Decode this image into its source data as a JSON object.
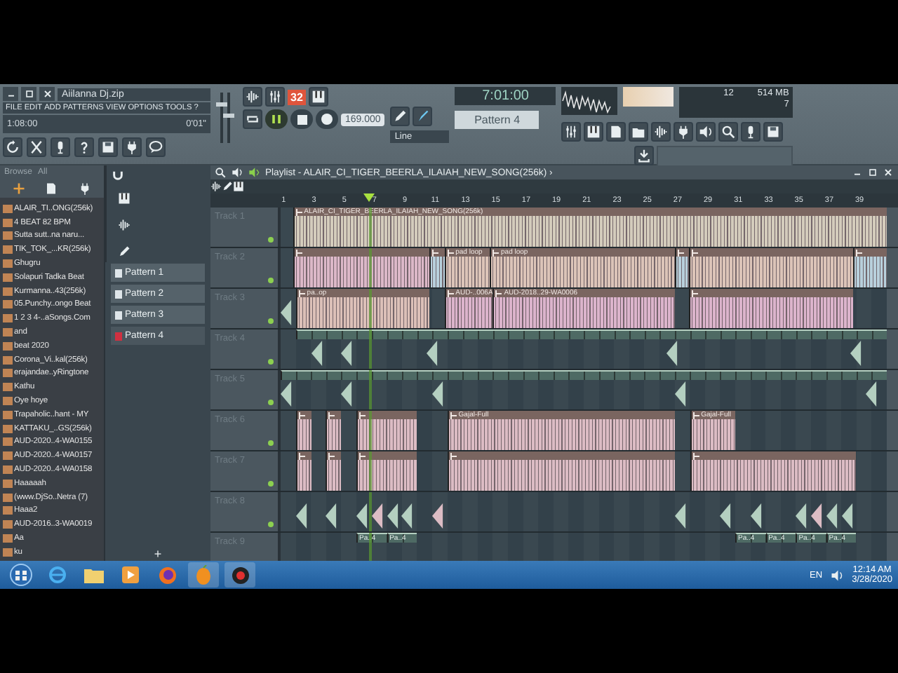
{
  "window": {
    "title": "Aiilanna Dj.zip"
  },
  "menu": [
    "FILE",
    "EDIT",
    "ADD",
    "PATTERNS",
    "VIEW",
    "OPTIONS",
    "TOOLS",
    "?"
  ],
  "hint_bar": {
    "position": "1:08:00",
    "time": "0'01\""
  },
  "mixer": {
    "volume": {
      "level": 0.8
    },
    "pitch": {
      "level": 0.55
    }
  },
  "transport": {
    "playing": true,
    "beat_display": "32",
    "tempo": "169.000",
    "song_time": "7:01:00",
    "snap": "Line",
    "pattern": "Pattern 4",
    "cpu": "12",
    "memory": "514 MB",
    "polyphony": "7"
  },
  "browser": {
    "title": "Browse",
    "filter": "All",
    "items": [
      "ALAIR_TI..ONG(256k)",
      "4 BEAT 82 BPM",
      "Sutta sutt..na naru...",
      "TIK_TOK_...KR(256k)",
      "Ghugru",
      "Solapuri Tadka Beat",
      "Kurmanna..43(256k)",
      "05.Punchy..ongo Beat",
      "1 2 3 4-..aSongs.Com",
      "and",
      "beat 2020",
      "Corona_Vi..kal(256k)",
      "erajandae..yRingtone",
      "Kathu",
      "Oye hoye",
      "Trapaholic..hant - MY",
      "KATTAKU_..GS(256k)",
      "AUD-2020..4-WA0155",
      "AUD-2020..4-WA0157",
      "AUD-2020..4-WA0158",
      "Haaaaah",
      "(www.DjSo..Netra (7)",
      "Haaa2",
      "AUD-2016..3-WA0019",
      "Aa",
      "ku"
    ]
  },
  "patterns": {
    "items": [
      {
        "label": "Pattern 1",
        "selected": false
      },
      {
        "label": "Pattern 2",
        "selected": false
      },
      {
        "label": "Pattern 3",
        "selected": false
      },
      {
        "label": "Pattern 4",
        "selected": true
      }
    ],
    "add": "+"
  },
  "playlist": {
    "title": "Playlist - ALAIR_CI_TIGER_BEERLA_ILAIAH_NEW_SONG(256k)",
    "arrow": "›",
    "ruler": [
      "1",
      "3",
      "5",
      "7",
      "9",
      "11",
      "13",
      "15",
      "17",
      "19",
      "21",
      "23",
      "25",
      "27",
      "29",
      "31",
      "33",
      "35",
      "37",
      "39"
    ],
    "tracks": [
      {
        "name": "Track 1",
        "clips": [
          {
            "kind": "audio",
            "label": "ALAIR_CI_TIGER_BEERLA_ILAIAH_NEW_SONG(256k)",
            "color": "#d4ccbc"
          }
        ]
      },
      {
        "name": "Track 2",
        "clips": [
          {
            "kind": "audio",
            "color": "#dcb8c8"
          },
          {
            "kind": "audio",
            "color": "#b8d0dc"
          },
          {
            "kind": "audio",
            "label": "pad loop",
            "color": "#dcc4b8"
          },
          {
            "kind": "audio",
            "label": "pad loop",
            "color": "#dcc4b8"
          },
          {
            "kind": "audio",
            "color": "#b8d0dc"
          },
          {
            "kind": "audio",
            "color": "#dcc4b8"
          },
          {
            "kind": "audio",
            "color": "#b8d0dc"
          }
        ]
      },
      {
        "name": "Track 3",
        "clips": [
          {
            "kind": "shot",
            "color": "#b4cfc0"
          },
          {
            "kind": "audio",
            "label": "pa..op",
            "color": "#dcc0b8"
          },
          {
            "kind": "audio",
            "label": "AUD-..006A",
            "color": "#dcb4cc"
          },
          {
            "kind": "audio",
            "label": "AUD-2018..29-WA0006",
            "color": "#dcb4cc"
          },
          {
            "kind": "audio",
            "color": "#dcb4cc"
          }
        ]
      },
      {
        "name": "Track 4",
        "clips": [
          {
            "kind": "pattern",
            "color": "#b4cfc0"
          },
          {
            "kind": "shot",
            "color": "#b4cfc0"
          },
          {
            "kind": "shot",
            "color": "#b4cfc0"
          },
          {
            "kind": "shot",
            "color": "#b4cfc0"
          },
          {
            "kind": "shot",
            "color": "#b4cfc0"
          },
          {
            "kind": "shot",
            "color": "#b4cfc0"
          }
        ]
      },
      {
        "name": "Track 5",
        "clips": [
          {
            "kind": "pattern",
            "color": "#b4cfc0"
          },
          {
            "kind": "shot",
            "color": "#b4cfc0"
          },
          {
            "kind": "shot",
            "color": "#b4cfc0"
          },
          {
            "kind": "shot",
            "color": "#b4cfc0"
          },
          {
            "kind": "shot",
            "color": "#b4cfc0"
          },
          {
            "kind": "shot",
            "color": "#b4cfc0"
          }
        ]
      },
      {
        "name": "Track 6",
        "clips": [
          {
            "kind": "audio",
            "color": "#dcbcc4"
          },
          {
            "kind": "audio",
            "color": "#dcbcc4"
          },
          {
            "kind": "audio",
            "color": "#dcbcc4"
          },
          {
            "kind": "audio",
            "label": "Gajal-Full",
            "color": "#dcbcc4"
          },
          {
            "kind": "audio",
            "label": "Gajal-Full",
            "color": "#dcbcc4"
          }
        ]
      },
      {
        "name": "Track 7",
        "clips": [
          {
            "kind": "audio",
            "color": "#dcbcc4"
          },
          {
            "kind": "audio",
            "color": "#dcbcc4"
          },
          {
            "kind": "audio",
            "color": "#dcbcc4"
          },
          {
            "kind": "audio",
            "color": "#dcbcc4"
          },
          {
            "kind": "audio",
            "color": "#dcbcc4"
          }
        ]
      },
      {
        "name": "Track 8",
        "clips": [
          {
            "kind": "shot",
            "color": "#b4cfc0"
          },
          {
            "kind": "shot",
            "color": "#b4cfc0"
          },
          {
            "kind": "shot",
            "color": "#b4cfc0"
          },
          {
            "kind": "shot",
            "color": "#dcbcc4"
          },
          {
            "kind": "shot",
            "color": "#b4cfc0"
          },
          {
            "kind": "shot",
            "color": "#b4cfc0"
          },
          {
            "kind": "shot",
            "color": "#dcbcc4"
          },
          {
            "kind": "shot",
            "color": "#b4cfc0"
          },
          {
            "kind": "shot",
            "color": "#b4cfc0"
          },
          {
            "kind": "shot",
            "color": "#b4cfc0"
          },
          {
            "kind": "shot",
            "color": "#b4cfc0"
          },
          {
            "kind": "shot",
            "color": "#dcbcc4"
          },
          {
            "kind": "shot",
            "color": "#b4cfc0"
          },
          {
            "kind": "shot",
            "color": "#b4cfc0"
          }
        ]
      },
      {
        "name": "Track 9",
        "clips": [
          {
            "kind": "pattern",
            "label": "Pa..4",
            "color": "#b4cfc0"
          },
          {
            "kind": "pattern",
            "label": "Pa..4",
            "color": "#b4cfc0"
          },
          {
            "kind": "pattern",
            "label": "Pa..4",
            "color": "#b4cfc0"
          },
          {
            "kind": "pattern",
            "label": "Pa..4",
            "color": "#b4cfc0"
          },
          {
            "kind": "pattern",
            "label": "Pa..4",
            "color": "#b4cfc0"
          },
          {
            "kind": "pattern",
            "label": "Pa..4",
            "color": "#b4cfc0"
          }
        ]
      }
    ]
  },
  "taskbar": {
    "language": "EN",
    "time": "12:14 AM",
    "date": "3/28/2020"
  }
}
